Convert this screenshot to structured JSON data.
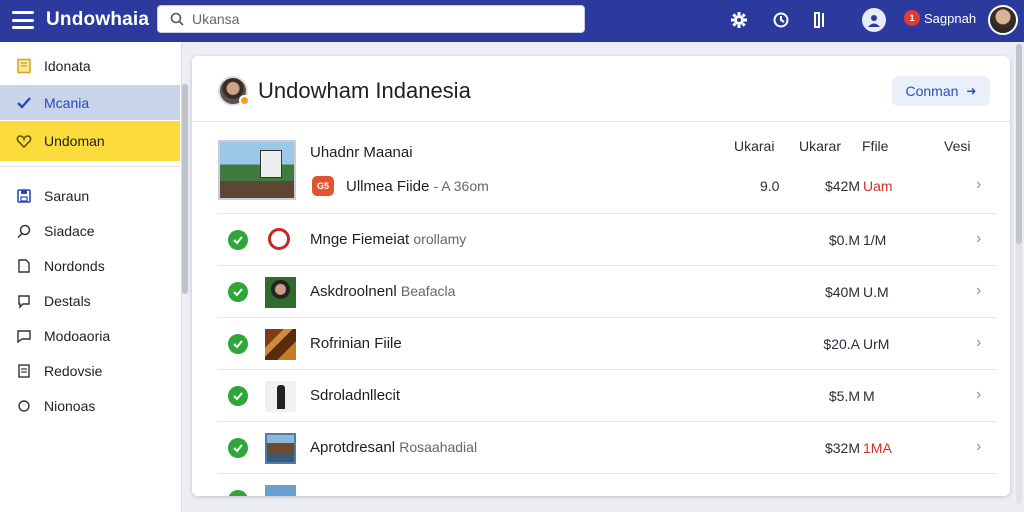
{
  "app": {
    "title": "Undowhaia",
    "search_placeholder": "Ukansa",
    "notification_count": "1",
    "user_name": "Sagpnah"
  },
  "toolbar": {
    "icons": [
      "settings-icon",
      "history-icon",
      "phone-icon",
      "account-icon"
    ]
  },
  "sidebar": {
    "items": [
      {
        "label": "Idonata",
        "icon": "folder-icon"
      },
      {
        "label": "Mcania",
        "icon": "check-icon"
      },
      {
        "label": "Undoman",
        "icon": "heart-icon"
      },
      {
        "label": "Saraun",
        "icon": "save-icon"
      },
      {
        "label": "Siadace",
        "icon": "search-icon"
      },
      {
        "label": "Nordonds",
        "icon": "document-icon"
      },
      {
        "label": "Destals",
        "icon": "chat-icon"
      },
      {
        "label": "Modoaoria",
        "icon": "message-icon"
      },
      {
        "label": "Redovsie",
        "icon": "list-icon"
      },
      {
        "label": "Nionoas",
        "icon": "circle-icon"
      }
    ]
  },
  "main": {
    "title": "Undowham Indanesia",
    "action_label": "Conman",
    "columns": [
      "Ukarai",
      "Ukarar",
      "Ffile",
      "Vesi"
    ],
    "first_item_title": "Uhadnr Maanai",
    "rows": [
      {
        "name": "Ullmea Fiide",
        "sub": "- A 36om",
        "c1": "9.0",
        "c2": "$42M",
        "c3": "Uam",
        "c3_red": true,
        "checked": false
      },
      {
        "name": "Mnge Fiemeiat",
        "sub": "orollamy",
        "c1": "",
        "c2": "$0.M",
        "c3": "1/M",
        "c3_red": false,
        "checked": true
      },
      {
        "name": "Askdroolnenl",
        "sub": "Beafacla",
        "c1": "",
        "c2": "$40M",
        "c3": "U.M",
        "c3_red": false,
        "checked": true
      },
      {
        "name": "Rofrinian Fiile",
        "sub": "",
        "c1": "",
        "c2": "$20.A",
        "c3": "UrM",
        "c3_red": false,
        "checked": true
      },
      {
        "name": "Sdroladnllecit",
        "sub": "",
        "c1": "",
        "c2": "$5.M",
        "c3": "M",
        "c3_red": false,
        "checked": true
      },
      {
        "name": "Aprotdresanl",
        "sub": "Rosaahadial",
        "c1": "",
        "c2": "$32M",
        "c3": "1MA",
        "c3_red": true,
        "checked": true
      }
    ]
  },
  "colors": {
    "topbar": "#2b3a9c",
    "active_blue": "#c9d4ea",
    "active_yellow": "#fbdc3c",
    "check_green": "#2ea63a",
    "alert_red": "#d32f2f"
  }
}
